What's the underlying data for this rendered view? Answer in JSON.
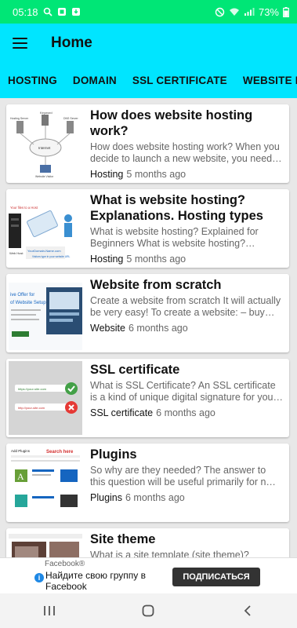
{
  "status": {
    "time": "05:18",
    "battery": "73%"
  },
  "appbar": {
    "title": "Home"
  },
  "tabs": [
    "HOSTING",
    "DOMAIN",
    "SSL CERTIFICATE",
    "WEBSITE B"
  ],
  "posts": [
    {
      "title": "How does website hosting work?",
      "desc": "How does website hosting work? When you decide to launch a new website, you need to…",
      "category": "Hosting",
      "time": "5 months ago",
      "thumb": "hosting-diagram"
    },
    {
      "title": "What is website hosting? Explanations. Hosting types",
      "desc": "What is website hosting? Explained for Beginners What is website hosting? Website…",
      "category": "Hosting",
      "time": "5 months ago",
      "thumb": "hosting-types"
    },
    {
      "title": "Website from scratch",
      "desc": "Create a website from scratch It will actually be very easy! To create a website: – buy hos…",
      "category": "Website",
      "time": "6 months ago",
      "thumb": "website-setup"
    },
    {
      "title": "SSL certificate",
      "desc": "What is SSL Certificate? An SSL certificate is a kind of unique digital signature for your …",
      "category": "SSL certificate",
      "time": "6 months ago",
      "thumb": "ssl-check"
    },
    {
      "title": "Plugins",
      "desc": "So why are they needed? The answer to this question will be useful primarily for n…",
      "category": "Plugins",
      "time": "6 months ago",
      "thumb": "plugins"
    },
    {
      "title": "Site theme",
      "desc": "What is a site template (site theme)?",
      "category": "",
      "time": "",
      "thumb": "theme"
    }
  ],
  "thumb_text": {
    "keyword": "Keyword",
    "hosting_server": "Hosting Server",
    "dns_server": "DNS Server",
    "internet": "Internet",
    "website_visitor": "Website Visitor",
    "your_files": "Your files to a Host",
    "web_host": "Web Host",
    "domain_url": "YourDomain-Name.com",
    "visitors_url": "Visitors type in your website URL",
    "offer": "ive Offer for",
    "setup": "of Website Setup",
    "plugins_title": "Add Plugins",
    "search_here": "Search here",
    "ssl_url1": "https://your-site.com",
    "ssl_url2": "http://your-site.com"
  },
  "ad": {
    "brand": "Facebook®",
    "text": "Найдите свою группу в Facebook",
    "button": "ПОДПИСАТЬСЯ",
    "info": "i"
  },
  "colors": {
    "status_bar": "#00e676",
    "app_bar": "#00e5ff"
  }
}
